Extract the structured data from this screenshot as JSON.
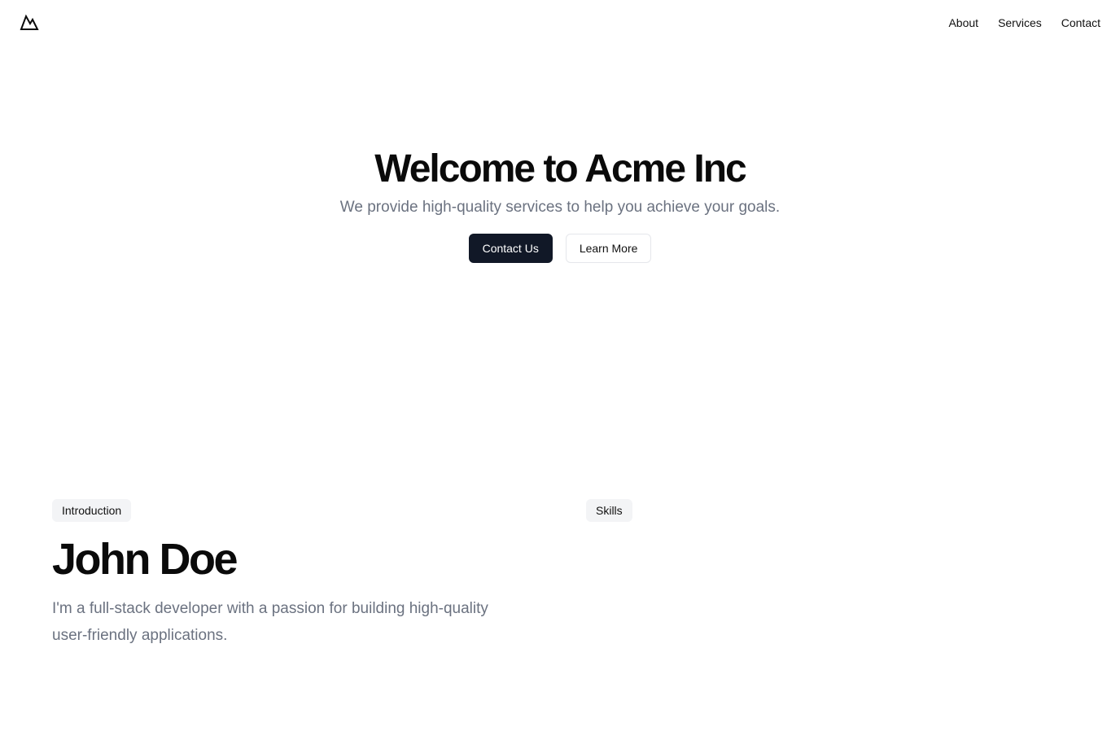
{
  "header": {
    "logo_icon": "mountain-icon",
    "nav": [
      {
        "label": "About"
      },
      {
        "label": "Services"
      },
      {
        "label": "Contact"
      }
    ]
  },
  "hero": {
    "title": "Welcome to Acme Inc",
    "subtitle": "We provide high-quality services to help you achieve your goals.",
    "primary_button": "Contact Us",
    "secondary_button": "Learn More"
  },
  "intro": {
    "badge": "Introduction",
    "name": "John Doe",
    "bio": "I'm a full-stack developer with a passion for building high-quality user-friendly applications."
  },
  "skills": {
    "badge": "Skills"
  },
  "colors": {
    "primary": "#111827",
    "muted_text": "#6b7280",
    "badge_bg": "#f3f4f6"
  }
}
